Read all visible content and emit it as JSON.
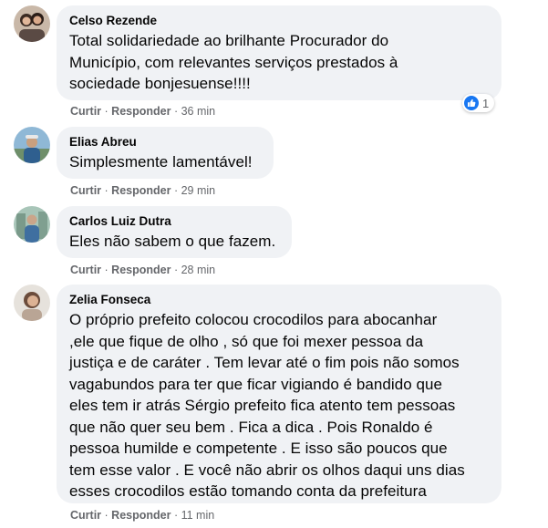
{
  "actions": {
    "like": "Curtir",
    "reply": "Responder",
    "separator": "·"
  },
  "colors": {
    "bubble": "#f0f2f5",
    "meta_text": "#65676b",
    "like_blue": "#1877f2"
  },
  "comments": [
    {
      "author": "Celso Rezende",
      "text": "Total solidariedade ao brilhante Procurador do\nMunicípio, com relevantes serviços prestados à\nsociedade bonjesuense!!!!",
      "time": "36 min",
      "reaction_icon": "like-icon",
      "reaction_count": "1"
    },
    {
      "author": "Elias Abreu",
      "text": "Simplesmente lamentável!",
      "time": "29 min"
    },
    {
      "author": "Carlos Luiz Dutra",
      "text": "Eles não sabem o que fazem.",
      "time": "28 min"
    },
    {
      "author": "Zelia Fonseca",
      "text": "O próprio prefeito colocou crocodilos para abocanhar\n,ele que fique de olho , só que foi mexer pessoa da\njustiça e de caráter . Tem levar até o fim pois não somos\nvagabundos para ter que ficar vigiando é bandido que\neles tem ir atrás Sérgio prefeito fica atento tem pessoas\nque não quer seu bem . Fica a dica . Pois Ronaldo é\npessoa humilde e competente . E isso são poucos que\ntem esse valor . E você não abrir os olhos daqui uns dias\nesses crocodilos estão tomando conta da prefeitura",
      "time": "11 min"
    }
  ]
}
